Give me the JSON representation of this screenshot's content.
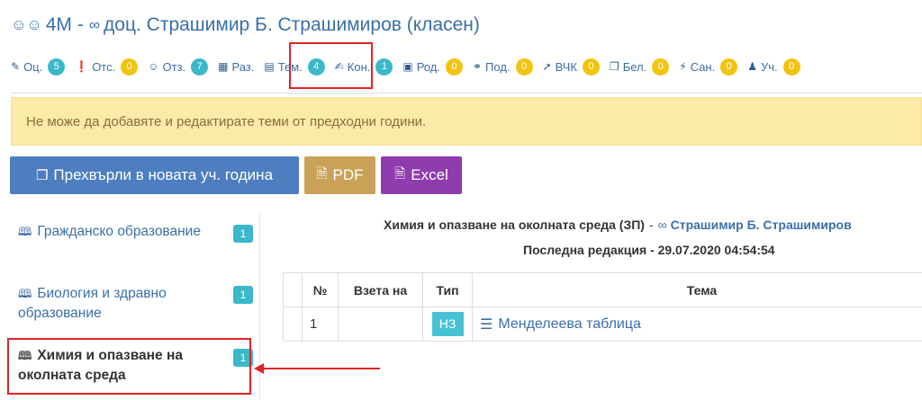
{
  "header": {
    "class_icon": "group-icon",
    "class_name": "4М",
    "separator": "-",
    "teacher_icon": "glasses-icon",
    "teacher_name": "доц. Страшимир Б. Страшимиров (класен)"
  },
  "nav": [
    {
      "icon": "pencil-icon",
      "glyph": "✎",
      "label": "Оц.",
      "count": "5",
      "badge_color": "#3bb8c9"
    },
    {
      "icon": "alert-icon",
      "glyph": "❗",
      "label": "Отс.",
      "count": "0",
      "badge_color": "#f1c40f"
    },
    {
      "icon": "users-icon",
      "glyph": "☺",
      "label": "Отз.",
      "count": "7",
      "badge_color": "#3bb8c9"
    },
    {
      "icon": "table-icon",
      "glyph": "▦",
      "label": "Раз.",
      "count": "",
      "badge_color": ""
    },
    {
      "icon": "list-alt-icon",
      "glyph": "▤",
      "label": "Тем.",
      "count": "4",
      "badge_color": "#3bb8c9"
    },
    {
      "icon": "edit-icon",
      "glyph": "✍",
      "label": "Кон.",
      "count": "1",
      "badge_color": "#3bb8c9"
    },
    {
      "icon": "calendar-icon",
      "glyph": "▣",
      "label": "Род.",
      "count": "0",
      "badge_color": "#f1c40f"
    },
    {
      "icon": "handshake-icon",
      "glyph": "⚭",
      "label": "Под.",
      "count": "0",
      "badge_color": "#f1c40f"
    },
    {
      "icon": "thumbs-up-icon",
      "glyph": "➚",
      "label": "ВЧК",
      "count": "0",
      "badge_color": "#f1c40f"
    },
    {
      "icon": "note-icon",
      "glyph": "❒",
      "label": "Бел.",
      "count": "0",
      "badge_color": "#f1c40f"
    },
    {
      "icon": "bolt-icon",
      "glyph": "⚡",
      "label": "Сан.",
      "count": "0",
      "badge_color": "#f1c40f"
    },
    {
      "icon": "graduate-icon",
      "glyph": "♟",
      "label": "Уч.",
      "count": "0",
      "badge_color": "#f1c40f"
    }
  ],
  "alert": {
    "text": "Не може да добавяте и редактирате теми от предходни години."
  },
  "buttons": {
    "move_label": "Прехвърли в новата уч. година",
    "pdf_label": "PDF",
    "excel_label": "Excel"
  },
  "subjects": [
    {
      "label": "Гражданско образование",
      "count": "1",
      "active": false
    },
    {
      "label": "Биология и здравно образование",
      "count": "1",
      "active": false
    },
    {
      "label": "Химия и опазване на околната среда",
      "count": "1",
      "active": true
    }
  ],
  "main": {
    "subject_title": "Химия и опазване на околната среда (ЗП)",
    "subject_dash": "-",
    "teacher": "Страшимир Б. Страшимиров",
    "last_edit": "Последна редакция - 29.07.2020 04:54:54"
  },
  "table": {
    "headers": [
      "№",
      "Взета на",
      "Тип",
      "Тема"
    ],
    "rows": [
      {
        "num": "1",
        "taken_on": "",
        "type": "НЗ",
        "topic": "Менделеева таблица"
      }
    ]
  },
  "colors": {
    "link": "#3a6fa8",
    "badge_teal": "#3bb8c9",
    "badge_yellow": "#f1c40f",
    "alert_bg": "#fbeaa8",
    "btn_blue": "#4d7ec0",
    "btn_pdf": "#c9a257",
    "btn_excel": "#8e3cae",
    "highlight": "#e02424"
  }
}
